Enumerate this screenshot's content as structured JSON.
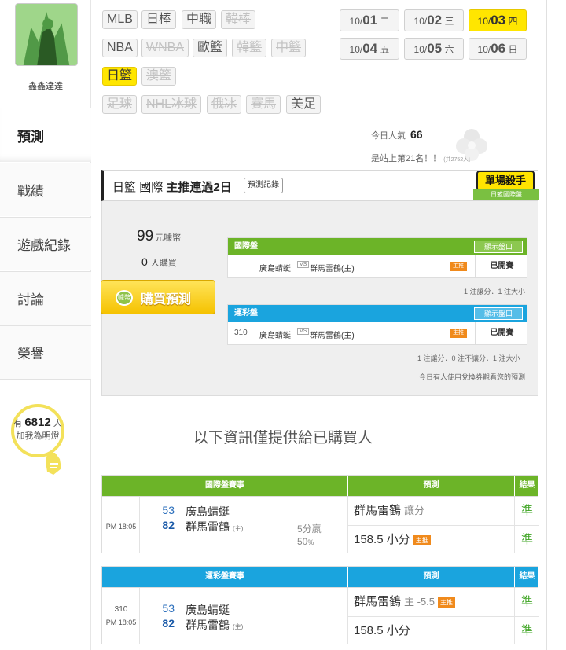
{
  "user": {
    "name": "鑫鑫達達"
  },
  "nav": [
    {
      "label": "預測",
      "active": true
    },
    {
      "label": "戰績"
    },
    {
      "label": "遊戲紀錄"
    },
    {
      "label": "討論"
    },
    {
      "label": "榮譽"
    }
  ],
  "lamp": {
    "prefix": "有",
    "count": "6812",
    "suffix": "人",
    "sub": "加我為明燈"
  },
  "leagues": {
    "row1": [
      "MLB",
      "日棒",
      "中職",
      "韓棒"
    ],
    "row2": [
      "NBA",
      "WNBA",
      "歐籃",
      "韓籃",
      "中籃"
    ],
    "row3": [
      "日籃",
      "澳籃"
    ],
    "row4": [
      "足球",
      "NHL冰球",
      "俄冰",
      "賽馬",
      "美足"
    ]
  },
  "dates": [
    {
      "month": "10/",
      "day": "01",
      "weekday": "二"
    },
    {
      "month": "10/",
      "day": "02",
      "weekday": "三"
    },
    {
      "month": "10/",
      "day": "03",
      "weekday": "四"
    },
    {
      "month": "10/",
      "day": "04",
      "weekday": "五"
    },
    {
      "month": "10/",
      "day": "05",
      "weekday": "六"
    },
    {
      "month": "10/",
      "day": "06",
      "weekday": "日"
    }
  ],
  "popularity": {
    "label": "今日人氣",
    "value": "66",
    "rank": "是站上第21名！！",
    "total": "(共2752人)"
  },
  "prediction": {
    "league": "日籃",
    "type": "國際",
    "streak": "主推連過2日",
    "record_button": "預測記錄",
    "badge_title": "單場殺手",
    "badge_sub": "日籃國際盤",
    "price": "99",
    "price_unit": "元噱幣",
    "buyers": "0",
    "buyers_unit": "人購買",
    "buy_button": "購買預測",
    "coin_label": "噱幣"
  },
  "intl_mini": {
    "header": "國際盤",
    "show_button": "顯示盤口",
    "idx": "",
    "away": "廣島蜻蜓",
    "vs": "VS",
    "home": "群馬雷鶴(主)",
    "tag": "主推",
    "state": "已開賽",
    "note": "1 注讓分．1 注大小"
  },
  "lottery_mini": {
    "header": "運彩盤",
    "show_button": "顯示盤口",
    "idx": "310",
    "away": "廣島蜻蜓",
    "vs": "VS",
    "home": "群馬雷鶴(主)",
    "tag": "主推",
    "state": "已開賽",
    "note": "1 注讓分．0 注不讓分．1 注大小",
    "note2": "今日有人使用兌換券觀看您的預測"
  },
  "info_message": "以下資訊僅提供給已購買人",
  "intl_result": {
    "col1": "國際盤賽事",
    "col2": "預測",
    "col3": "結果",
    "idx": "",
    "time": "PM 18:05",
    "away_score": "53",
    "away_name": "廣島蜻蜓",
    "home_score": "82",
    "home_name": "群馬雷鶴",
    "home_tag": "(主)",
    "margin": "5分贏",
    "pct": "50",
    "pct_unit": "%",
    "pick1": "群馬雷鶴",
    "pick1_extra": "讓分",
    "pick2": "158.5 小分",
    "pick2_tag": "主推",
    "result1": "準",
    "result2": "準"
  },
  "lottery_result": {
    "col1": "運彩盤賽事",
    "col2": "預測",
    "col3": "結果",
    "idx": "310",
    "time": "PM 18:05",
    "away_score": "53",
    "away_name": "廣島蜻蜓",
    "home_score": "82",
    "home_name": "群馬雷鶴",
    "home_tag": "(主)",
    "pick1": "群馬雷鶴",
    "pick1_extra": "主 -5.5",
    "pick1_tag": "主推",
    "pick2": "158.5 小分",
    "result1": "準",
    "result2": "準"
  },
  "colors": {
    "green": "#6cb428",
    "blue": "#1aa4de",
    "yellow": "#ffe600",
    "orange": "#f08a1c"
  }
}
